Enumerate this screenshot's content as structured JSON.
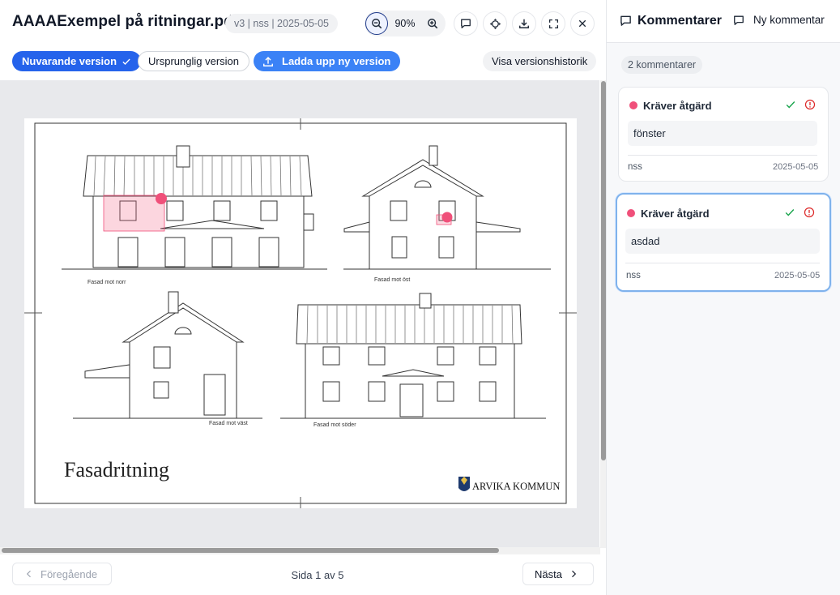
{
  "header": {
    "title": "AAAAExempel på ritningar.pdf",
    "meta": "v3 | nss | 2025-05-05",
    "zoom": "90%"
  },
  "versions": {
    "current_label": "Nuvarande version",
    "original_label": "Ursprunglig version",
    "upload_label": "Ladda upp ny version",
    "history_label": "Visa versionshistorik"
  },
  "drawing": {
    "label_north": "Fasad mot norr",
    "label_east": "Fasad mot öst",
    "label_west": "Fasad mot väst",
    "label_south": "Fasad mot söder",
    "sheet_title": "Fasadritning",
    "municipality": "ARVIKA KOMMUN"
  },
  "footer": {
    "prev_label": "Föregående",
    "page_indicator": "Sida 1 av 5",
    "next_label": "Nästa"
  },
  "comments_panel": {
    "title": "Kommentarer",
    "new_label": "Ny kommentar",
    "count_label": "2 kommentarer",
    "items": [
      {
        "status": "Kräver åtgärd",
        "text": "fönster",
        "author": "nss",
        "date": "2025-05-05"
      },
      {
        "status": "Kräver åtgärd",
        "text": "asdad",
        "author": "nss",
        "date": "2025-05-05"
      }
    ]
  },
  "colors": {
    "primary": "#2563eb",
    "upload": "#3b82f6",
    "marker": "#f0507a",
    "resolve": "#16a34a",
    "alert": "#dc2626",
    "active_border": "#7fb2ec"
  }
}
